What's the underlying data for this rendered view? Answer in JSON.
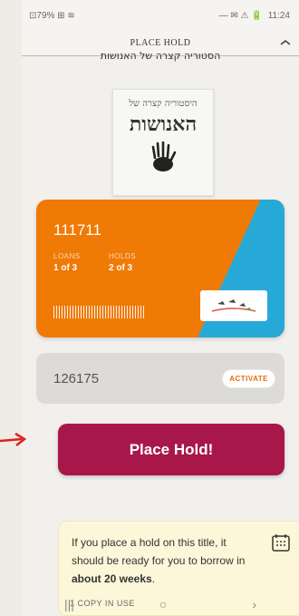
{
  "status_bar": {
    "left": "⊡79%  ⊞ ≋",
    "time": "11:24",
    "icons": "— ✉ ⚠ 🔋"
  },
  "topbar": {
    "title": "PLACE HOLD"
  },
  "book": {
    "title_strip": "הסטוריה קצרה של האנושות",
    "cover_subtitle": "היסטוריה קצרה של",
    "cover_title": "האנושות"
  },
  "card": {
    "number": "111711",
    "col1_label": "LOANS",
    "col1_value": "1 of 3",
    "col2_label": "HOLDS",
    "col2_value": "2 of 3",
    "colors": {
      "orange": "#f07a06",
      "blue": "#27a9d8"
    }
  },
  "activate": {
    "code": "126175",
    "button_label": "ACTIVATE"
  },
  "place_hold": {
    "label": "Place Hold!",
    "color": "#a8174a"
  },
  "info": {
    "prefix": "If you place a hold on this title, it should be ready for you to borrow in ",
    "emphasis": "about 20 weeks",
    "suffix": ".",
    "copies_line": "1    COPY IN USE"
  },
  "navbar": {
    "recent": "|||",
    "home": "○",
    "back": "›"
  }
}
